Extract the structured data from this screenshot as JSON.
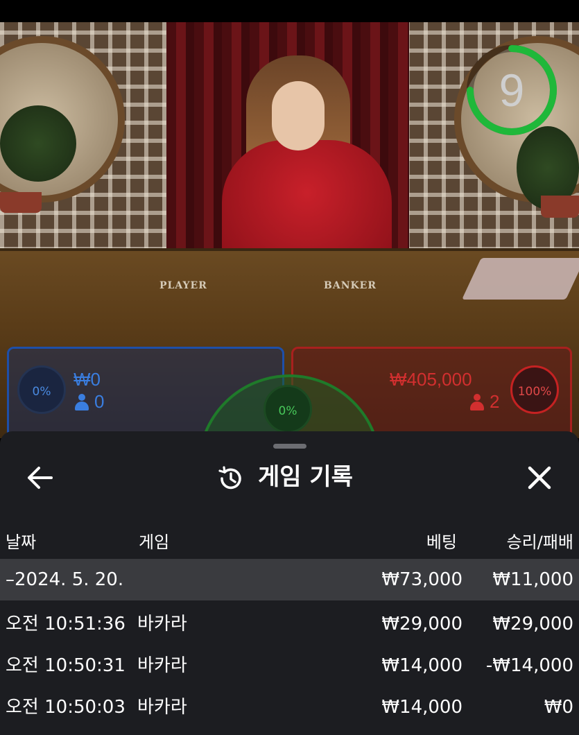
{
  "video": {
    "timer_value": "9",
    "table_labels": {
      "player": "PLAYER",
      "banker": "BANKER"
    }
  },
  "bets": {
    "player": {
      "percent": "0%",
      "amount": "₩0",
      "count": "0"
    },
    "tie": {
      "percent": "0%"
    },
    "banker": {
      "percent": "100%",
      "amount": "₩405,000",
      "count": "2"
    }
  },
  "history": {
    "title": "게임 기록",
    "back_icon": "arrow-left-icon",
    "close_icon": "close-icon",
    "title_icon": "history-icon",
    "columns": {
      "date": "날짜",
      "game": "게임",
      "bet": "베팅",
      "result": "승리/패배"
    },
    "date_group": {
      "date": "–2024. 5. 20.",
      "bet": "₩73,000",
      "result": "₩11,000"
    },
    "rows": [
      {
        "time": "오전 10:51:36",
        "game": "바카라",
        "bet": "₩29,000",
        "result": "₩29,000"
      },
      {
        "time": "오전 10:50:31",
        "game": "바카라",
        "bet": "₩14,000",
        "result": "-₩14,000"
      },
      {
        "time": "오전 10:50:03",
        "game": "바카라",
        "bet": "₩14,000",
        "result": "₩0"
      }
    ]
  },
  "colors": {
    "player_blue": "#1e4fa8",
    "banker_red": "#a8201e",
    "tie_green": "#1f7a2a",
    "sheet_bg": "#1c1d21",
    "date_row_bg": "#3a3b3f",
    "timer_green": "#1fb83a"
  }
}
